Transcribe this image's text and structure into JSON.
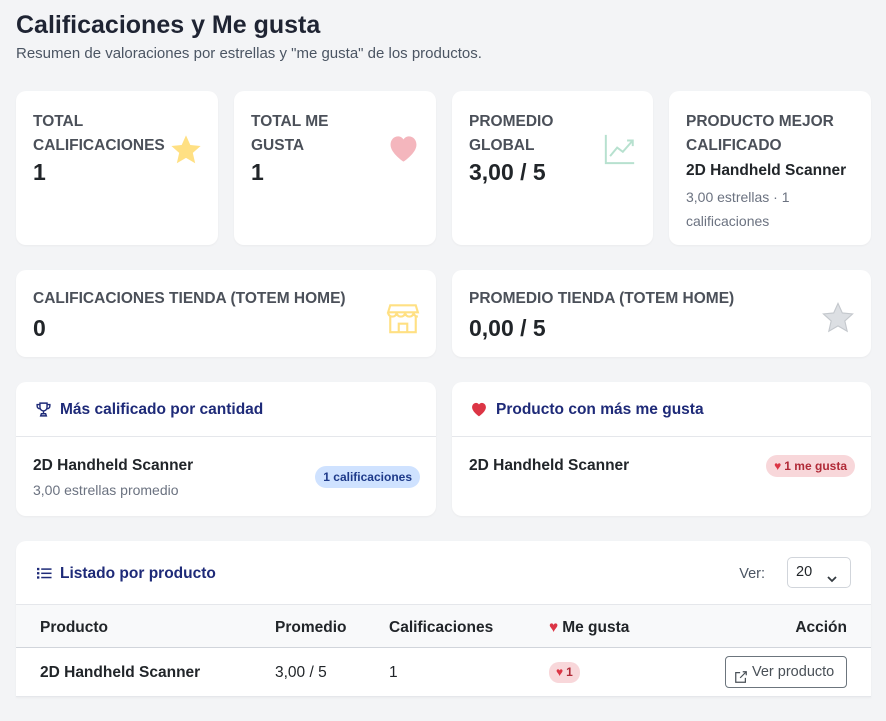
{
  "page": {
    "title": "Calificaciones y Me gusta",
    "subtitle": "Resumen de valoraciones por estrellas y \"me gusta\" de los productos."
  },
  "stats": {
    "total_ratings": {
      "label_line1": "TOTAL",
      "label_line2": "CALIFICACIONES",
      "value": "1",
      "icon": "star-icon",
      "color": "#ffe083"
    },
    "total_likes": {
      "label_line1": "TOTAL ME",
      "label_line2": "GUSTA",
      "value": "1",
      "icon": "heart-icon",
      "color": "#f4b6bd"
    },
    "global_avg": {
      "label_line1": "PROMEDIO",
      "label_line2": "GLOBAL",
      "value": "3,00 / 5",
      "icon": "chart-line-icon",
      "color": "#b7e1cf"
    },
    "best_product": {
      "label_line1": "PRODUCTO MEJOR",
      "label_line2": "CALIFICADO",
      "name": "2D Handheld Scanner",
      "meta": "3,00 estrellas · 1 calificaciones"
    },
    "store_ratings": {
      "label": "CALIFICACIONES TIENDA (TOTEM HOME)",
      "value": "0",
      "icon": "shop-icon",
      "color": "#ffe083"
    },
    "store_avg": {
      "label": "PROMEDIO TIENDA (TOTEM HOME)",
      "value": "0,00 / 5",
      "icon": "star-outline-icon",
      "color": "#d1d5db"
    }
  },
  "most_rated": {
    "title": "Más calificado por cantidad",
    "product": "2D Handheld Scanner",
    "sub": "3,00 estrellas promedio",
    "badge": "1 calificaciones"
  },
  "most_liked": {
    "title": "Producto con más me gusta",
    "product": "2D Handheld Scanner",
    "badge": "1 me gusta"
  },
  "listing": {
    "title": "Listado por producto",
    "ver_label": "Ver:",
    "page_size": "20",
    "columns": {
      "product": "Producto",
      "avg": "Promedio",
      "ratings": "Calificaciones",
      "likes": "Me gusta",
      "action": "Acción"
    },
    "rows": [
      {
        "product": "2D Handheld Scanner",
        "avg": "3,00 / 5",
        "ratings": "1",
        "likes": "1",
        "action": "Ver producto"
      }
    ]
  },
  "colors": {
    "accent_dark_blue": "#1e2a78",
    "heart_red": "#dc3545",
    "badge_blue_bg": "#cfe2ff",
    "badge_red_bg": "#f8d7da"
  }
}
